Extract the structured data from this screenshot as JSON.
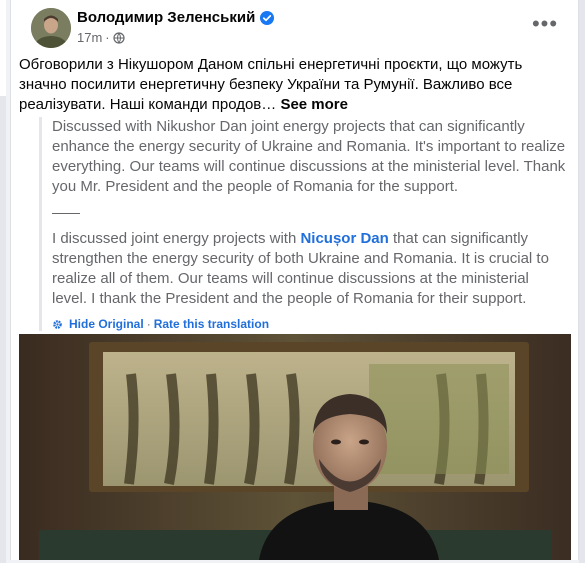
{
  "post": {
    "author": "Володимир Зеленський",
    "time": "17m",
    "time_separator": "·",
    "text": "Обговорили з Нікушором Даном спільні енергетичні проєкти, що можуть значно посилити енергетичну безпеку України та Румунії. Важливо все реалізувати. Наші команди продов…",
    "see_more": "See more"
  },
  "translation": {
    "paragraph1": "Discussed with Nikushor Dan joint energy projects that can significantly enhance the energy security of Ukraine and Romania. It's important to realize everything. Our teams will continue discussions at the ministerial level. Thank you Mr. President and the people of Romania for the support.",
    "paragraph2_before": "I discussed joint energy projects with ",
    "paragraph2_tag": "Nicușor Dan",
    "paragraph2_after": " that can significantly strengthen the energy security of both Ukraine and Romania. It is crucial to realize all of them. Our teams will continue discussions at the ministerial level. I thank the President and the people of Romania for their support.",
    "hide_original": "Hide Original",
    "separator": "·",
    "rate": "Rate this translation"
  },
  "icons": {
    "verified": "verified-badge-icon",
    "globe": "globe-icon",
    "more": "more-options-icon",
    "gear": "gear-icon"
  },
  "colors": {
    "link_blue": "#216fdb",
    "verified_blue": "#1877f2",
    "secondary_text": "#65676b"
  }
}
